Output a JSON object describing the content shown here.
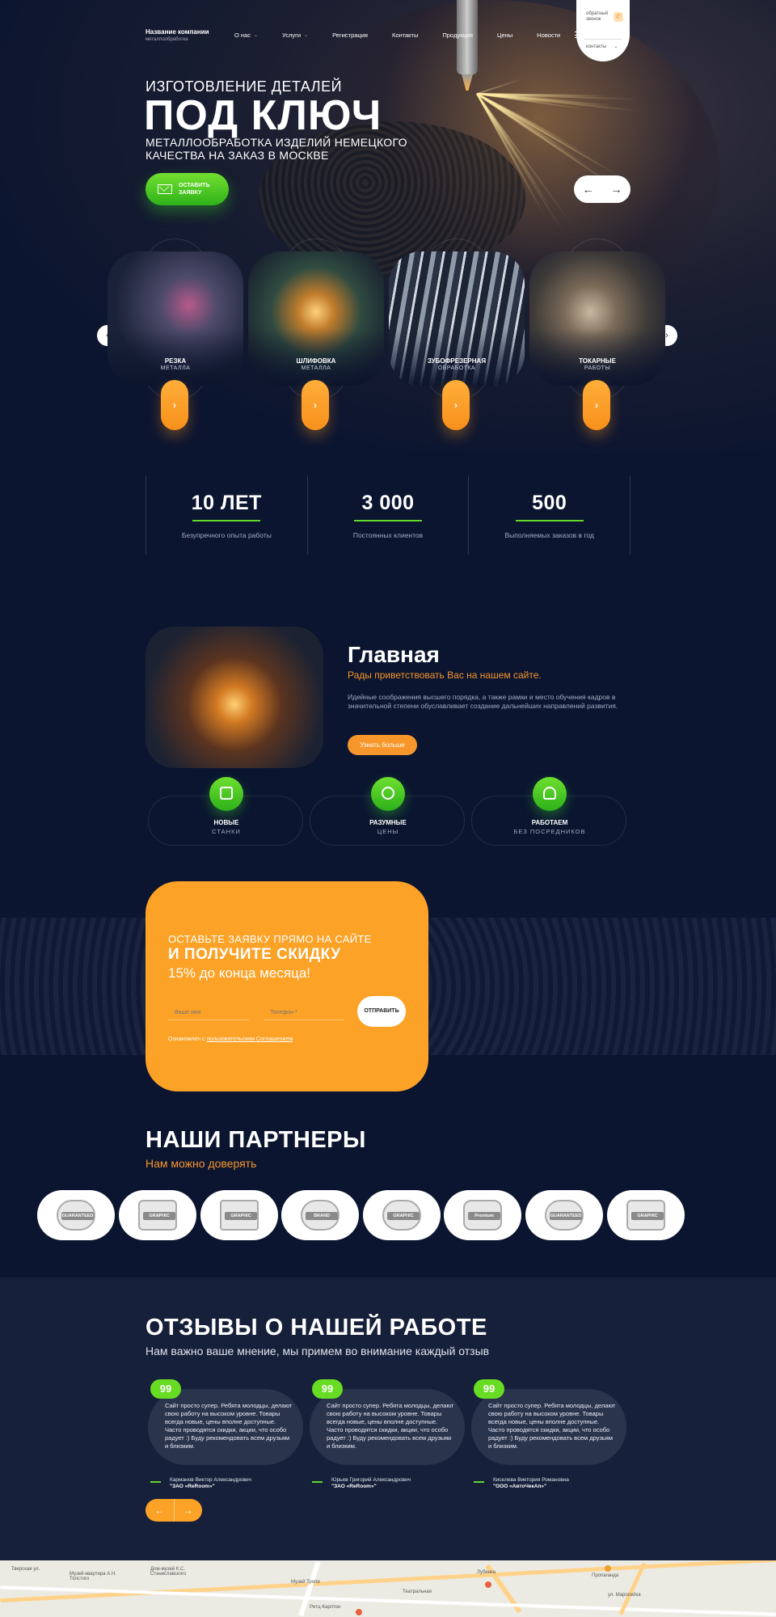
{
  "header": {
    "brand_name": "Название компании",
    "brand_sub": "металлообработка",
    "menu": [
      {
        "label": "О нас",
        "dropdown": true
      },
      {
        "label": "Услуги",
        "dropdown": true
      },
      {
        "label": "Регистрация",
        "dropdown": false
      },
      {
        "label": "Контакты",
        "dropdown": false
      },
      {
        "label": "Продукция",
        "dropdown": false
      },
      {
        "label": "Цены",
        "dropdown": false
      },
      {
        "label": "Новости",
        "dropdown": false
      }
    ],
    "callback_label": "обратный звонок",
    "contacts_label": "контакты"
  },
  "hero": {
    "pretitle": "ИЗГОТОВЛЕНИЕ ДЕТАЛЕЙ",
    "title": "ПОД КЛЮЧ",
    "subtitle": "МЕТАЛЛООБРАБОТКА ИЗДЕЛИЙ НЕМЕЦКОГО КАЧЕСТВА НА ЗАКАЗ В МОСКВЕ",
    "cta_label": "ОСТАВИТЬ ЗАЯВКУ",
    "prev": "←",
    "next": "→"
  },
  "services": [
    {
      "title": "РЕЗКА",
      "sub": "МЕТАЛЛА"
    },
    {
      "title": "ШЛИФОВКА",
      "sub": "МЕТАЛЛА"
    },
    {
      "title": "ЗУБОФРЕЗЕРНАЯ",
      "sub": "ОБРАБОТКА"
    },
    {
      "title": "ТОКАРНЫЕ",
      "sub": "РАБОТЫ"
    }
  ],
  "services_arrow": "›",
  "carousel": {
    "prev": "‹",
    "next": "›"
  },
  "stats": [
    {
      "value": "10 ЛЕТ",
      "label": "Безупречного опыта работы"
    },
    {
      "value": "3 000",
      "label": "Постоянных клиентов"
    },
    {
      "value": "500",
      "label": "Выполняемых заказов в год"
    }
  ],
  "about": {
    "title": "Главная",
    "subtitle": "Рады приветствовать Вас на нашем сайте.",
    "text": "Идейные соображения высшего порядка, а также рамки и место обучения кадров в значительной степени обуславливает создание дальнейших направлений развития.",
    "button": "Узнать больше"
  },
  "features": [
    {
      "title": "НОВЫЕ",
      "sub": "СТАНКИ",
      "icon": "machine-icon"
    },
    {
      "title": "РАЗУМНЫЕ",
      "sub": "ЦЕНЫ",
      "icon": "handshake-icon"
    },
    {
      "title": "РАБОТАЕМ",
      "sub": "БЕЗ ПОСРЕДНИКОВ",
      "icon": "worker-icon"
    }
  ],
  "cta": {
    "pretitle": "ОСТАВЬТЕ ЗАЯВКУ ПРЯМО НА САЙТЕ",
    "title": "И ПОЛУЧИТЕ СКИДКУ",
    "subtitle": "15% до конца месяца!",
    "name_placeholder": "Ваше имя",
    "phone_placeholder": "Телефон *",
    "send": "ОТПРАВИТЬ",
    "consent_prefix": "Ознакомлен с",
    "consent_link": "пользовательским Соглашением"
  },
  "partners": {
    "title": "НАШИ ПАРТНЕРЫ",
    "subtitle": "Нам можно доверять",
    "logos": [
      "GUARANTEED",
      "GRAPHIC DESIGN",
      "GRAPHIC",
      "BRAND",
      "GRAPHIC",
      "Premium",
      "GUARANTEED",
      "GRAPHIC DESIGN"
    ]
  },
  "reviews": {
    "title": "ОТЗЫВЫ О НАШЕЙ РАБОТЕ",
    "subtitle": "Нам важно ваше мнение, мы примем во внимание каждый отзыв",
    "items": [
      {
        "text": "Сайт просто супер. Ребята молодцы, делают свою работу на высоком уровне. Товары всегда новые, цены вполне доступные. Часто проводятся скидки, акции, что особо радует :) Буду рекомендовать всем друзьям и близким.",
        "name": "Карманов Виктор Александрович",
        "company": "\"ЗАО «ReRoom»\""
      },
      {
        "text": "Сайт просто супер. Ребята молодцы, делают свою работу на высоком уровне. Товары всегда новые, цены вполне доступные. Часто проводятся скидки, акции, что особо радует :) Буду рекомендовать всем друзьям и близким.",
        "name": "Юрьев Григорий Александрович",
        "company": "\"ЗАО «ReRoom»\""
      },
      {
        "text": "Сайт просто супер. Ребята молодцы, делают свою работу на высоком уровне. Товары всегда новые, цены вполне доступные. Часто проводятся скидки, акции, что особо радует :) Буду рекомендовать всем друзьям и близким.",
        "name": "Киселева Виктория Романовна",
        "company": "\"ООО «АвтоЧекАп»\""
      }
    ],
    "quote_mark": "99",
    "prev": "←",
    "next": "→"
  },
  "map": {
    "labels": [
      "Музей-квартира А.Н. Толстого",
      "Дом-музей К.С. Станиславского",
      "Музей Тропи",
      "Театральная",
      "Ритц-Карлтон",
      "Лубянка",
      "Пропаганда",
      "ул. Маросейка",
      "Тверская ул."
    ]
  },
  "colors": {
    "accent_orange": "#fca227",
    "accent_green": "#63d92a",
    "background": "#0b1530"
  }
}
